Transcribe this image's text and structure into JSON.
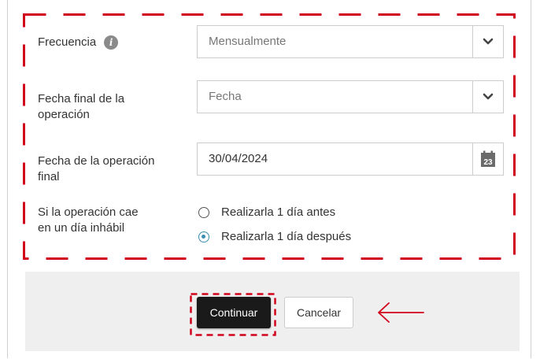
{
  "form": {
    "frequency": {
      "label": "Frecuencia",
      "info_icon": "info-icon",
      "selected": "Mensualmente",
      "caret_icon": "chevron-down-icon"
    },
    "end_date_type": {
      "label_line1": "Fecha final de la",
      "label_line2": "operación",
      "selected": "Fecha",
      "caret_icon": "chevron-down-icon"
    },
    "end_date": {
      "label_line1": "Fecha de la operación",
      "label_line2": "final",
      "value": "30/04/2024",
      "calendar_icon": "calendar-icon",
      "calendar_day": "23"
    },
    "non_business_day": {
      "label_line1": "Si la operación cae",
      "label_line2": "en un día inhábil",
      "options": [
        {
          "label": "Realizarla 1 día antes",
          "checked": false
        },
        {
          "label": "Realizarla 1 día después",
          "checked": true
        }
      ]
    }
  },
  "actions": {
    "continue_label": "Continuar",
    "cancel_label": "Cancelar"
  },
  "annotation": {
    "highlight_color": "#d0021b",
    "arrow_icon": "arrow-left-icon"
  },
  "colors": {
    "radio_selected": "#3a8fb0",
    "primary_button": "#1a1a1a",
    "footer_bg": "#efefef"
  }
}
